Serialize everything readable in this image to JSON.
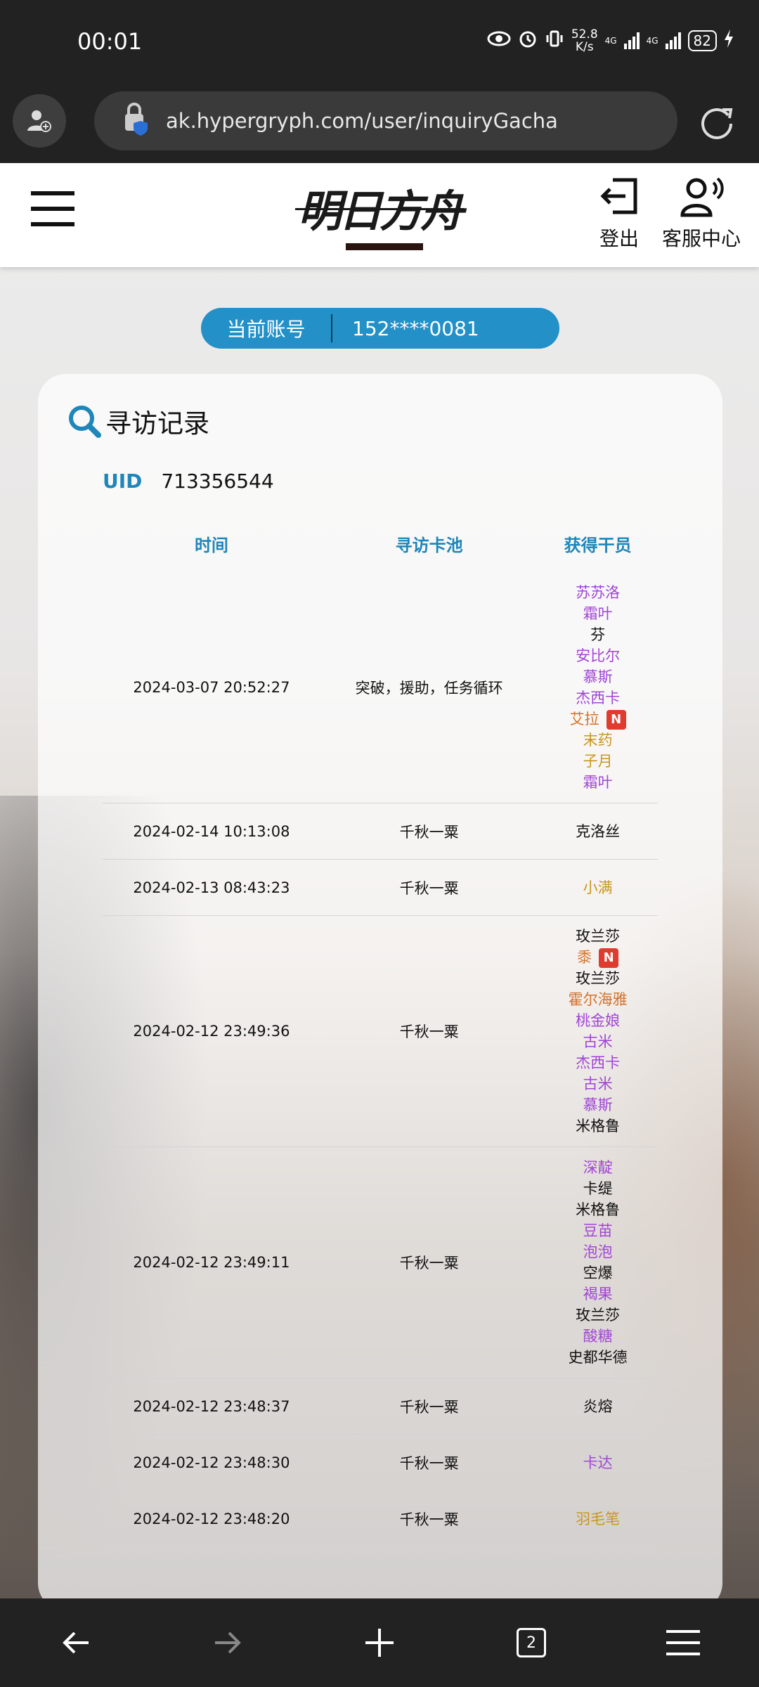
{
  "status_bar": {
    "time": "00:01",
    "net_speed_value": "52.8",
    "net_speed_unit": "K/s",
    "net_type": "4G",
    "battery": "82"
  },
  "browser": {
    "url": "ak.hypergryph.com/user/inquiryGacha",
    "tab_count": "2"
  },
  "header": {
    "logo_text": "明日方舟",
    "logout_label": "登出",
    "service_label": "客服中心"
  },
  "account": {
    "label": "当前账号",
    "value": "152****0081"
  },
  "card": {
    "title": "寻访记录",
    "uid_label": "UID",
    "uid_value": "713356544"
  },
  "table": {
    "columns": [
      "时间",
      "寻访卡池",
      "获得干员"
    ],
    "rows": [
      {
        "time": "2024-03-07 20:52:27",
        "pool": "突破，援助，任务循环",
        "ops": [
          {
            "name": "苏苏洛",
            "rarity": "r4"
          },
          {
            "name": "霜叶",
            "rarity": "r4"
          },
          {
            "name": "芬",
            "rarity": "r3"
          },
          {
            "name": "安比尔",
            "rarity": "r4"
          },
          {
            "name": "慕斯",
            "rarity": "r4"
          },
          {
            "name": "杰西卡",
            "rarity": "r4"
          },
          {
            "name": "艾拉",
            "rarity": "r6",
            "new": "N"
          },
          {
            "name": "末药",
            "rarity": "r5"
          },
          {
            "name": "子月",
            "rarity": "r5"
          },
          {
            "name": "霜叶",
            "rarity": "r4"
          }
        ]
      },
      {
        "time": "2024-02-14 10:13:08",
        "pool": "千秋一粟",
        "ops": [
          {
            "name": "克洛丝",
            "rarity": "r3"
          }
        ]
      },
      {
        "time": "2024-02-13 08:43:23",
        "pool": "千秋一粟",
        "ops": [
          {
            "name": "小满",
            "rarity": "r5"
          }
        ]
      },
      {
        "time": "2024-02-12 23:49:36",
        "pool": "千秋一粟",
        "ops": [
          {
            "name": "玫兰莎",
            "rarity": "r3"
          },
          {
            "name": "黍",
            "rarity": "r6",
            "new": "N"
          },
          {
            "name": "玫兰莎",
            "rarity": "r3"
          },
          {
            "name": "霍尔海雅",
            "rarity": "r6"
          },
          {
            "name": "桃金娘",
            "rarity": "r4"
          },
          {
            "name": "古米",
            "rarity": "r4"
          },
          {
            "name": "杰西卡",
            "rarity": "r4"
          },
          {
            "name": "古米",
            "rarity": "r4"
          },
          {
            "name": "慕斯",
            "rarity": "r4"
          },
          {
            "name": "米格鲁",
            "rarity": "r3"
          }
        ]
      },
      {
        "time": "2024-02-12 23:49:11",
        "pool": "千秋一粟",
        "ops": [
          {
            "name": "深靛",
            "rarity": "r4"
          },
          {
            "name": "卡缇",
            "rarity": "r3"
          },
          {
            "name": "米格鲁",
            "rarity": "r3"
          },
          {
            "name": "豆苗",
            "rarity": "r4"
          },
          {
            "name": "泡泡",
            "rarity": "r4"
          },
          {
            "name": "空爆",
            "rarity": "r3"
          },
          {
            "name": "褐果",
            "rarity": "r4"
          },
          {
            "name": "玫兰莎",
            "rarity": "r3"
          },
          {
            "name": "酸糖",
            "rarity": "r4"
          },
          {
            "name": "史都华德",
            "rarity": "r3"
          }
        ]
      },
      {
        "time": "2024-02-12 23:48:37",
        "pool": "千秋一粟",
        "ops": [
          {
            "name": "炎熔",
            "rarity": "r3"
          }
        ]
      },
      {
        "time": "2024-02-12 23:48:30",
        "pool": "千秋一粟",
        "ops": [
          {
            "name": "卡达",
            "rarity": "r4"
          }
        ]
      },
      {
        "time": "2024-02-12 23:48:20",
        "pool": "千秋一粟",
        "ops": [
          {
            "name": "羽毛笔",
            "rarity": "r5"
          }
        ]
      }
    ]
  },
  "colors": {
    "accent": "#2390c8",
    "rarity_6": "#d4722b",
    "rarity_5": "#c9961e",
    "rarity_4": "#a145d6",
    "rarity_3": "#111111",
    "new_badge": "#e03b2f"
  }
}
